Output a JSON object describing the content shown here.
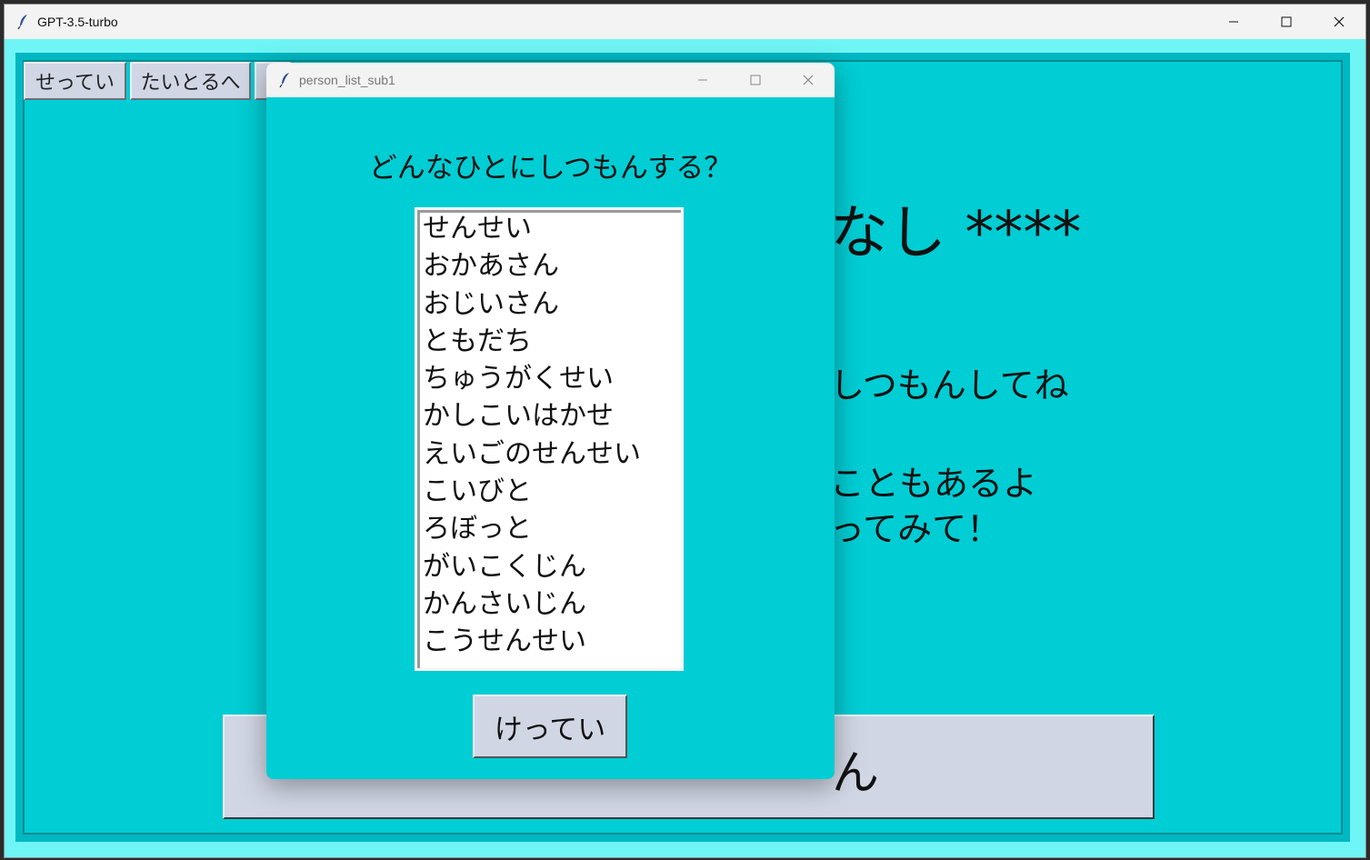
{
  "main_window": {
    "title": "GPT-3.5-turbo",
    "controls": {
      "minimize_icon": "minimize-icon",
      "maximize_icon": "maximize-icon",
      "close_icon": "close-icon"
    }
  },
  "toolbar": {
    "settings_label": "せってい",
    "to_title_label": "たいとるへ",
    "third_label_partial": "‹"
  },
  "background": {
    "heading_partial": "なし ****",
    "line1_partial": "しつもんしてね",
    "line2_partial": "こともあるよ",
    "line3_partial": "ってみて！",
    "big_button_partial": "ん"
  },
  "dialog": {
    "title": "person_list_sub1",
    "question": "どんなひとにしつもんする？",
    "list_items": [
      "せんせい",
      "おかあさん",
      "おじいさん",
      "ともだち",
      "ちゅうがくせい",
      "かしこいはかせ",
      "えいごのせんせい",
      "こいびと",
      "ろぼっと",
      "がいこくじん",
      "かんさいじん",
      "こうせんせい"
    ],
    "decide_label": "けってい"
  },
  "colors": {
    "accent_background": "#00cdd4",
    "outer_frame": "#6ff5f5",
    "button_face": "#d0d6e4"
  }
}
